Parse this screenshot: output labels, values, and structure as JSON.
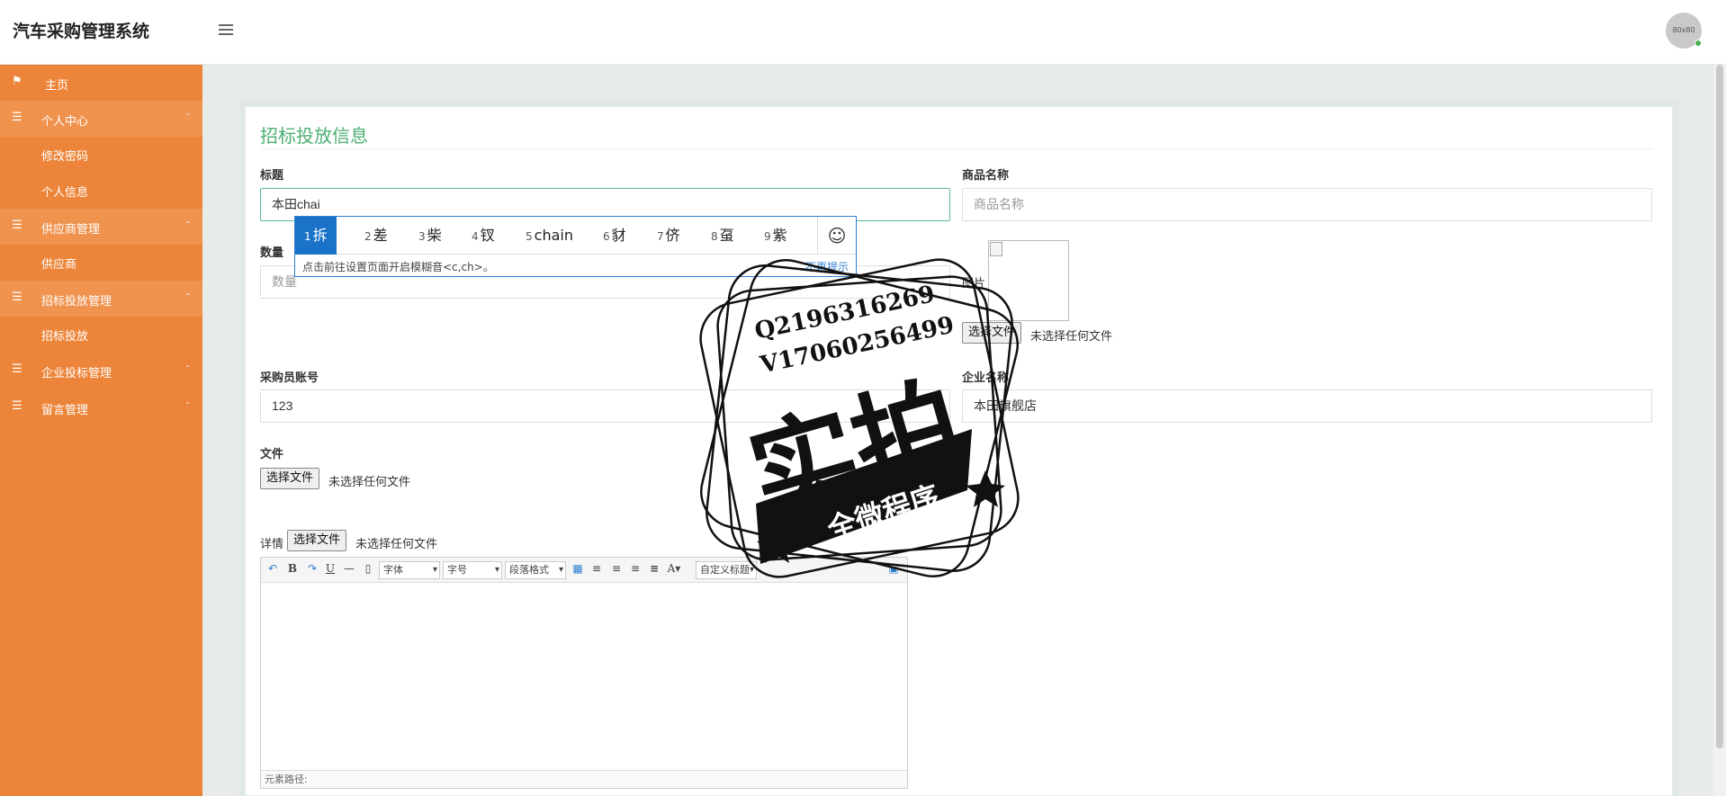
{
  "header": {
    "title": "汽车采购管理系统",
    "avatar_text": "80x80"
  },
  "sidebar": {
    "home": "主页",
    "groups": [
      {
        "label": "个人中心",
        "subs": [
          "修改密码",
          "个人信息"
        ]
      },
      {
        "label": "供应商管理",
        "subs": [
          "供应商"
        ]
      },
      {
        "label": "招标投放管理",
        "subs": [
          "招标投放"
        ]
      },
      {
        "label": "企业投标管理",
        "subs": []
      },
      {
        "label": "留言管理",
        "subs": []
      }
    ]
  },
  "form": {
    "title": "招标投放信息",
    "title_label": "标题",
    "title_value": "本田chai",
    "product_label": "商品名称",
    "product_placeholder": "商品名称",
    "quantity_label": "数量",
    "quantity_placeholder": "数量",
    "image_label": "图片",
    "choose_file": "选择文件",
    "no_file": "未选择任何文件",
    "buyer_label": "采购员账号",
    "buyer_value": "123",
    "company_label": "企业名称",
    "company_value": "本田旗舰店",
    "file_label": "文件",
    "details_label": "详情"
  },
  "editor": {
    "font_select": "字体",
    "size_select": "字号",
    "paragraph_select": "段落格式",
    "custom_title_select": "自定义标题",
    "status_path": "元素路径:"
  },
  "ime": {
    "candidates": [
      {
        "n": "1",
        "text": "拆"
      },
      {
        "n": "2",
        "text": "差"
      },
      {
        "n": "3",
        "text": "柴"
      },
      {
        "n": "4",
        "text": "钗"
      },
      {
        "n": "5",
        "text": "chain"
      },
      {
        "n": "6",
        "text": "豺"
      },
      {
        "n": "7",
        "text": "侪"
      },
      {
        "n": "8",
        "text": "虿"
      },
      {
        "n": "9",
        "text": "紫"
      }
    ],
    "hint": "点击前往设置页面开启模糊音<c,ch>。",
    "dismiss": "不再提示"
  },
  "watermark": {
    "line1": "Q2196316269",
    "line2": "V17060256499",
    "main": "实拍",
    "banner": "全微程序"
  },
  "colors": {
    "sidebar": "#ec853a",
    "sidebar_group": "#f0934f",
    "accent": "#4caf72",
    "ime_select": "#1a73c9"
  }
}
